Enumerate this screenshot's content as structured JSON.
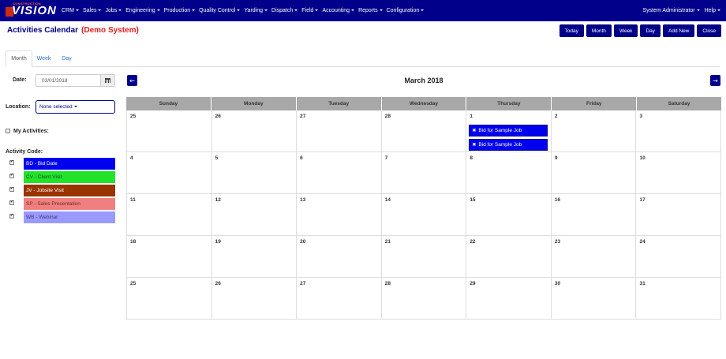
{
  "app": {
    "logo_text": "VISION",
    "logo_tagline": "CONSTRUCTION"
  },
  "nav": {
    "menus": [
      "CRM",
      "Sales",
      "Jobs",
      "Engineering",
      "Production",
      "Quality Control",
      "Yarding",
      "Dispatch",
      "Field",
      "Accounting",
      "Reports",
      "Configuration"
    ],
    "user": "System Administrator",
    "help": "Help"
  },
  "page": {
    "title": "Activities Calendar",
    "subtitle": "(Demo System)"
  },
  "toolbar": {
    "buttons": [
      "Today",
      "Month",
      "Week",
      "Day",
      "Add New",
      "Close"
    ]
  },
  "tabs": [
    "Month",
    "Week",
    "Day"
  ],
  "filters": {
    "date_label": "Date:",
    "date_value": "03/01/2018",
    "location_label": "Location:",
    "location_value": "None selected",
    "my_activities_label": "My Activities:",
    "activity_code_label": "Activity Code:",
    "codes": [
      {
        "label": "BD - Bid Date",
        "color": "#0000ee",
        "text_color": "#ffffff",
        "checked": true
      },
      {
        "label": "CV - Client Visit",
        "color": "#22e22a",
        "text_color": "#1a4a1a",
        "checked": true
      },
      {
        "label": "JV - Jobsite Visit",
        "color": "#993300",
        "text_color": "#ffffff",
        "checked": true
      },
      {
        "label": "SP - Sales Presentation",
        "color": "#f08080",
        "text_color": "#6a2a2a",
        "checked": true
      },
      {
        "label": "WB - Webinar",
        "color": "#9999ff",
        "text_color": "#3a3a7a",
        "checked": true
      }
    ]
  },
  "calendar": {
    "month_title": "March 2018",
    "prev_icon": "←",
    "next_icon": "→",
    "weekdays": [
      "Sunday",
      "Monday",
      "Tuesday",
      "Wednesday",
      "Thursday",
      "Friday",
      "Saturday"
    ],
    "weeks": [
      [
        "25",
        "26",
        "27",
        "28",
        "1",
        "2",
        "3"
      ],
      [
        "4",
        "5",
        "6",
        "7",
        "8",
        "9",
        "10"
      ],
      [
        "11",
        "12",
        "13",
        "14",
        "15",
        "16",
        "17"
      ],
      [
        "18",
        "19",
        "20",
        "21",
        "22",
        "23",
        "24"
      ],
      [
        "25",
        "26",
        "27",
        "28",
        "29",
        "30",
        "31"
      ]
    ],
    "events": [
      {
        "week": 0,
        "day": 4,
        "label": "Bid for Sample Job",
        "icon": "✖"
      },
      {
        "week": 0,
        "day": 4,
        "label": "Bid for Sample Job",
        "icon": "✖"
      }
    ]
  }
}
